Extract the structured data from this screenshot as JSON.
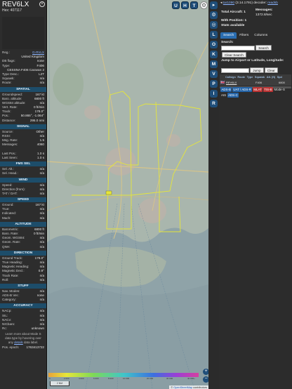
{
  "info": {
    "callsign": "REV6LX",
    "hex_label": "Hex: 407117",
    "rows1": [
      {
        "k": "Reg.:",
        "v": "G-RVLX",
        "link": true
      },
      {
        "k": "",
        "v": "United Kingdom"
      },
      {
        "k": "DB flags:",
        "v": "none"
      },
      {
        "k": "Type:",
        "v": "F406"
      },
      {
        "k": "",
        "v": "CESSNA F406 Caravan 2"
      },
      {
        "k": "Type Desc.:",
        "v": "L2T"
      },
      {
        "k": "Squawk:",
        "v": "n/a"
      },
      {
        "k": "Route:",
        "v": "n/a"
      }
    ],
    "spatial_title": "SPATIAL",
    "spatial": [
      {
        "k": "Groundspeed:",
        "v": "167 kt"
      },
      {
        "k": "Baro. altitude:",
        "v": "6800 ft"
      },
      {
        "k": "WGS84 altitude:",
        "v": "n/a"
      },
      {
        "k": "Vert. Rate:",
        "v": "0 ft/min"
      },
      {
        "k": "Track:",
        "v": "178.0°"
      },
      {
        "k": "Pos.:",
        "v": "50.865°, -1.064°"
      },
      {
        "k": "Distance:",
        "v": "295.0 nmi"
      }
    ],
    "signal_title": "SIGNAL",
    "signal": [
      {
        "k": "Source:",
        "v": "Other"
      },
      {
        "k": "RSSI:",
        "v": "n/a"
      },
      {
        "k": "Msg. Rate:",
        "v": "1.5"
      },
      {
        "k": "Messages:",
        "v": "4060"
      },
      {
        "k": "",
        "v": ""
      },
      {
        "k": "Last Pos.:",
        "v": "1.0 s"
      },
      {
        "k": "Last Seen:",
        "v": "1.0 s"
      }
    ],
    "fms_title": "FMS SEL",
    "fms": [
      {
        "k": "Sel. Alt.:",
        "v": "n/a"
      },
      {
        "k": "Sel. Head.:",
        "v": "n/a"
      }
    ],
    "wind_title": "WIND",
    "wind": [
      {
        "k": "Speed:",
        "v": "n/a"
      },
      {
        "k": "Direction (from):",
        "v": "n/a"
      },
      {
        "k": "TAT / OAT:",
        "v": "n/a"
      }
    ],
    "speed_title": "SPEED",
    "speed": [
      {
        "k": "Ground:",
        "v": "167 kt"
      },
      {
        "k": "True:",
        "v": "n/a"
      },
      {
        "k": "Indicated:",
        "v": "n/a"
      },
      {
        "k": "Mach:",
        "v": "n/a"
      }
    ],
    "altitude_title": "ALTITUDE",
    "altitude": [
      {
        "k": "Barometric:",
        "v": "6800 ft"
      },
      {
        "k": "Baro. Rate:",
        "v": "0 ft/min"
      },
      {
        "k": "Geom. WGS84:",
        "v": "n/a"
      },
      {
        "k": "Geom. Rate:",
        "v": "n/a"
      },
      {
        "k": "QNH:",
        "v": "n/a"
      }
    ],
    "direction_title": "DIRECTION",
    "direction": [
      {
        "k": "Ground Track:",
        "v": "178.0°"
      },
      {
        "k": "True Heading:",
        "v": "n/a"
      },
      {
        "k": "Magnetic Heading:",
        "v": "n/a"
      },
      {
        "k": "Magnetic Decl.:",
        "v": "0.9°"
      },
      {
        "k": "Track Rate:",
        "v": "n/a"
      },
      {
        "k": "Roll:",
        "v": "n/a"
      }
    ],
    "stuff_title": "STUFF",
    "stuff": [
      {
        "k": "Nav. Modes:",
        "v": "n/a"
      },
      {
        "k": "ADS-B Ver.:",
        "v": "none"
      },
      {
        "k": "Category:",
        "v": "n/a"
      }
    ],
    "accuracy_title": "ACCURACY",
    "accuracy": [
      {
        "k": "NACp:",
        "v": "n/a"
      },
      {
        "k": "SIL:",
        "v": "n/a"
      },
      {
        "k": "NACv:",
        "v": "n/a"
      },
      {
        "k": "NICbaro:",
        "v": "n/a"
      },
      {
        "k": "Rc:",
        "v": "unknown"
      }
    ],
    "note_pre": "Learn more about Mode S data type by hovering over any ",
    "note_link": "details",
    "note_post": " data label.",
    "epoch_label": "Pos. epoch:",
    "epoch_value": "1763413722"
  },
  "map": {
    "top_buttons": [
      "U",
      "H",
      "T"
    ],
    "alt_labels": [
      "0",
      "2 000",
      "4 000",
      "6 000",
      "8 000",
      "10 000",
      "20 000",
      "30 000",
      "40 000+"
    ],
    "scale_label": "2 NM",
    "zoom_in": "+",
    "zoom_out": "−",
    "attribution_prefix": "© ",
    "attribution_link": "OpenStreetMap",
    "attribution_suffix": " contributors",
    "track_color": "#e6e639",
    "aircraft_label": "REV6LX"
  },
  "toolbar": {
    "letters": [
      "L",
      "O",
      "K",
      "M",
      "V",
      "P",
      "I",
      "R"
    ]
  },
  "right": {
    "toggle": "◂",
    "version_link": "tar1090",
    "version": " (3.14.1791) decoder: ",
    "decoder_link": "readsb",
    "total_aircraft": "Total Aircraft: 1",
    "messages_label": "Messages:",
    "messages_rate": "1372.8/sec",
    "with_position": "With Position: 1",
    "stats_available": "Stats available",
    "tabs": [
      "Search",
      "Filters",
      "Columns"
    ],
    "search_label": "Search:",
    "search_button": "Search",
    "clear_search": "Clear Search",
    "jump_label": "Jump to Airport or Latitude, Longitude:",
    "jump_button": "Jump",
    "clear_button": "Clear",
    "columns": [
      "Callsign",
      "Route",
      "Type",
      "Squawk",
      "Alt. (ft)",
      "Spd"
    ],
    "row": {
      "flag": "🇬🇧",
      "callsign": "REV6LX",
      "type": "F406",
      "altitude": "6800"
    },
    "tags": [
      {
        "label": "ADS-B",
        "style": "blue"
      },
      {
        "label": "UAT / ADS-R",
        "style": "blue"
      },
      {
        "label": "MLAT",
        "style": "red"
      },
      {
        "label": "TIS-B",
        "style": "red"
      },
      {
        "label": "Mode-S",
        "style": "plain"
      },
      {
        "label": "AIS",
        "style": "plain"
      },
      {
        "label": "ADS-C",
        "style": "blue"
      }
    ]
  }
}
